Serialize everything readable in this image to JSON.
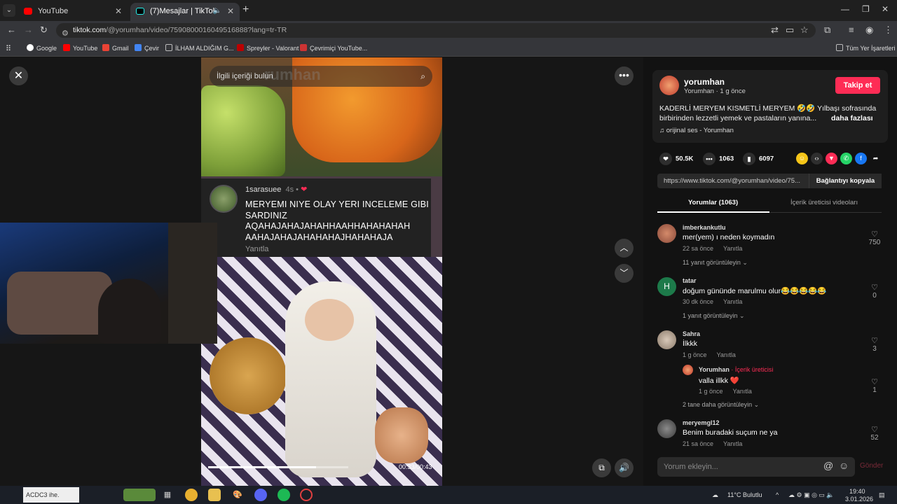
{
  "browser": {
    "tabs": [
      {
        "title": "YouTube",
        "favicon": "youtube-icon"
      },
      {
        "title": "(7)Mesajlar | TikTok",
        "favicon": "tiktok-icon"
      }
    ],
    "address": {
      "host": "tiktok.com",
      "path": "/@yorumhan/video/7590800016049516888?lang=tr-TR"
    },
    "bookmarks": [
      {
        "label": "Google",
        "color": "#ffffff"
      },
      {
        "label": "YouTube",
        "color": "#ff0000"
      },
      {
        "label": "Gmail",
        "color": "#ea4335"
      },
      {
        "label": "Çevir",
        "color": "#4285f4"
      },
      {
        "label": "İLHAM ALDIĞIM G...",
        "color": "#bbbbbb"
      },
      {
        "label": "Spreyler - Valorant",
        "color": "#bb0000"
      },
      {
        "label": "Çevrimiçi YouTube...",
        "color": "#cc3333"
      }
    ],
    "all_bookmarks": "Tüm Yer İşaretleri"
  },
  "video": {
    "search_placeholder": "İlgili içeriği bulun",
    "ghost_text": "rumhan",
    "time": "00:33/00:43",
    "progress": 0.77,
    "overlay_comment": {
      "user": "1sarasuee",
      "time": "4s",
      "text": "MERYEMI NIYE OLAY YERI INCELEME GIBI SARDINIZ AQAHAJAHAJAHAHHAAHHAHAHAHAH AAHAJAHAJAHAHAHAJHAHAHAJA",
      "reply": "Yanıtla"
    }
  },
  "author": {
    "name": "yorumhan",
    "sub": "Yorumhan · 1 g önce",
    "follow": "Takip et",
    "description": "KADERLİ MERYEM KISMETLİ MERYEM 🤣🤣 Yılbaşı sofrasında birbirinden lezzetli yemek ve pastaların yanına...",
    "more": "daha fazlası",
    "music": "♫  orijinal ses - Yorumhan"
  },
  "stats": {
    "likes": "50.5K",
    "comments": "1063",
    "saves": "6097"
  },
  "link": {
    "url": "https://www.tiktok.com/@yorumhan/video/75...",
    "copy": "Bağlantıyı kopyala"
  },
  "tabs": {
    "comments": "Yorumlar (1063)",
    "creator_videos": "İçerik üreticisi videoları"
  },
  "comments": [
    {
      "user": "imberkankutlu",
      "text": "mer(yem) ı neden koymadın",
      "time": "22 sa önce",
      "reply": "Yanıtla",
      "likes": "750",
      "view": "11 yanıt görüntüleyin ⌄"
    },
    {
      "user": "tatar",
      "text": "doğum gününde marulmu olur😂😂😂😂😂",
      "time": "30 dk önce",
      "reply": "Yanıtla",
      "likes": "0",
      "view": "1 yanıt görüntüleyin ⌄"
    },
    {
      "user": "Sahra",
      "text": "İlkkk",
      "time": "1 g önce",
      "reply": "Yanıtla",
      "likes": "3",
      "view": "2 tane daha görüntüleyin ⌄"
    },
    {
      "user": "meryemgl12",
      "text": "Benim buradaki suçum ne ya",
      "time": "21 sa önce",
      "reply": "Yanıtla",
      "likes": "52"
    }
  ],
  "creator_reply": {
    "user": "Yorumhan",
    "badge": " · İçerik üreticisi",
    "text": "valla illkk ❤️",
    "time": "1 g önce",
    "reply": "Yanıtla",
    "likes": "1"
  },
  "input": {
    "placeholder": "Yorum ekleyin...",
    "send": "Gönder"
  },
  "taskbar": {
    "weather": "11°C  Bulutlu",
    "time": "19:40",
    "date": "3.01.2026",
    "widget": "ACDC3 ihe."
  }
}
